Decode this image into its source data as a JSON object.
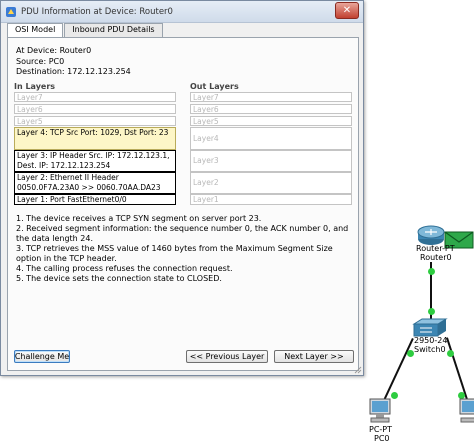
{
  "window": {
    "title": "PDU Information at Device: Router0"
  },
  "tabs": [
    {
      "label": "OSI Model",
      "active": true
    },
    {
      "label": "Inbound PDU Details",
      "active": false
    }
  ],
  "info": {
    "device": "At Device: Router0",
    "source": "Source: PC0",
    "destination": "Destination: 172.12.123.254"
  },
  "in_layers": {
    "header": "In Layers",
    "items": [
      {
        "label": "Layer7"
      },
      {
        "label": "Layer6"
      },
      {
        "label": "Layer5"
      },
      {
        "label": "Layer 4: TCP Src Port: 1029, Dst Port: 23"
      },
      {
        "label": "Layer 3: IP Header Src. IP: 172.12.123.1, Dest. IP: 172.12.123.254"
      },
      {
        "label": "Layer 2: Ethernet II Header 0050.0F7A.23A0 >> 0060.70AA.DA23"
      },
      {
        "label": "Layer 1: Port FastEthernet0/0"
      }
    ]
  },
  "out_layers": {
    "header": "Out Layers",
    "items": [
      {
        "label": "Layer7"
      },
      {
        "label": "Layer6"
      },
      {
        "label": "Layer5"
      },
      {
        "label": "Layer4"
      },
      {
        "label": "Layer3"
      },
      {
        "label": "Layer2"
      },
      {
        "label": "Layer1"
      }
    ]
  },
  "steps": [
    "1. The device receives a TCP SYN segment on server port 23.",
    "2. Received segment information: the sequence number 0, the ACK number 0, and the data length 24.",
    "3. TCP retrieves the MSS value of 1460 bytes from the Maximum Segment Size option in the TCP header.",
    "4. The calling process refuses the connection request.",
    "5. The device sets the connection state to CLOSED."
  ],
  "buttons": {
    "challenge": "Challenge Me",
    "previous": "<< Previous Layer",
    "next": "Next Layer >>"
  },
  "topology": {
    "router_label": "Router-PT",
    "router_name": "Router0",
    "switch_label": "2950-24",
    "switch_name": "Switch0",
    "pc_label": "PC-PT",
    "pc_name": "PC0",
    "link_color": "#2ecc40"
  }
}
